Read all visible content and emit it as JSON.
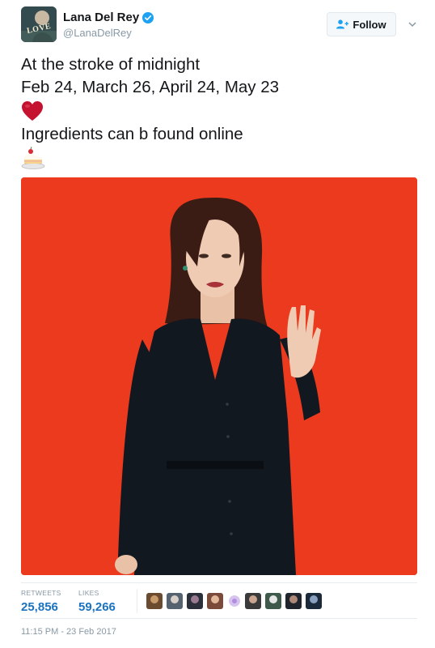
{
  "author": {
    "display_name": "Lana Del Rey",
    "handle": "@LanaDelRey",
    "avatar_text": "LOVE",
    "verified": true
  },
  "follow": {
    "label": "Follow"
  },
  "tweet": {
    "line1": "At the stroke of midnight",
    "line2": "Feb 24, March 26, April 24, May 23",
    "line3": "Ingredients can b found online",
    "emoji1": "red-heart",
    "emoji2": "cake-slice"
  },
  "stats": {
    "retweets_label": "RETWEETS",
    "retweets_value": "25,856",
    "likes_label": "LIKES",
    "likes_value": "59,266",
    "likers_count_shown": 9
  },
  "timestamp": "11:15 PM - 23 Feb 2017",
  "colors": {
    "link_blue": "#1b73c0",
    "verified_blue": "#1da1f2",
    "media_background": "#ec3a1e",
    "muted_text": "#8899a6"
  }
}
